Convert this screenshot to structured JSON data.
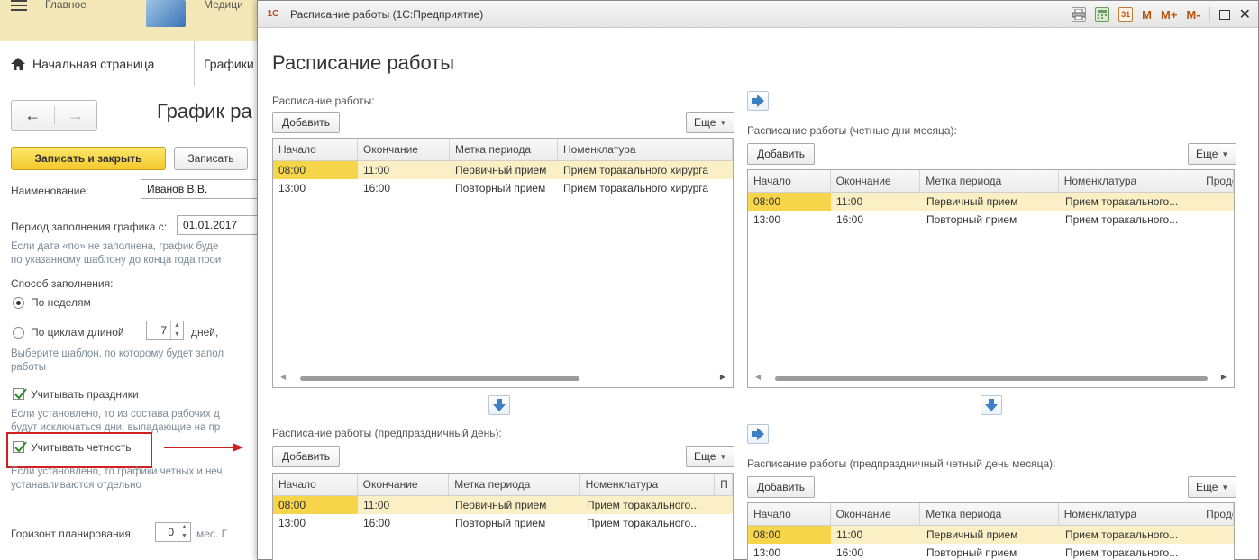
{
  "background": {
    "top_text_left": "Главное",
    "top_text_right": "Медици",
    "home_tab": "Начальная страница",
    "second_tab": "Графики",
    "form_title": "График ра",
    "btn_save_close": "Записать и закрыть",
    "btn_save": "Записать",
    "name_label": "Наименование:",
    "name_value": "Иванов В.В.",
    "period_label": "Период заполнения графика с:",
    "period_value": "01.01.2017",
    "hint_period_1": "Если дата «по» не заполнена, график буде",
    "hint_period_2": "по указанному шаблону до конца года прои",
    "fill_method_label": "Способ заполнения:",
    "radio_weeks": "По неделям",
    "radio_cycles": "По циклам длиной",
    "cycle_value": "7",
    "cycle_unit": "дней,",
    "hint_template_1": "Выберите шаблон, по которому будет запол",
    "hint_template_2": "работы",
    "chk_holidays": "Учитывать праздники",
    "hint_holidays_1": "Если установлено, то из состава рабочих д",
    "hint_holidays_2": "будут исключаться дни, выпадающие на пр",
    "chk_parity": "Учитывать четность",
    "hint_parity_1": "Если установлено, то графики четных и неч",
    "hint_parity_2": "устанавливаются отдельно",
    "horizon_label": "Горизонт планирования:",
    "horizon_value": "0",
    "horizon_unit": "мес. Г"
  },
  "window": {
    "title": "Расписание работы  (1С:Предприятие)",
    "app_logo": "1С",
    "tools": [
      "M",
      "M+",
      "M-"
    ],
    "heading": "Расписание работы"
  },
  "labels": {
    "add": "Добавить",
    "more": "Еще"
  },
  "panels": {
    "main": {
      "label": "Расписание работы:",
      "columns": [
        "Начало",
        "Окончание",
        "Метка периода",
        "Номенклатура"
      ],
      "rows": [
        [
          "08:00",
          "11:00",
          "Первичный прием",
          "Прием торакального хирурга"
        ],
        [
          "13:00",
          "16:00",
          "Повторный прием",
          "Прием торакального хирурга"
        ]
      ]
    },
    "even": {
      "label": "Расписание работы (четные дни месяца):",
      "columns": [
        "Начало",
        "Окончание",
        "Метка периода",
        "Номенклатура",
        "Продо"
      ],
      "rows": [
        [
          "08:00",
          "11:00",
          "Первичный прием",
          "Прием торакального..."
        ],
        [
          "13:00",
          "16:00",
          "Повторный прием",
          "Прием торакального..."
        ]
      ]
    },
    "preholiday": {
      "label": "Расписание работы (предпраздничный день):",
      "columns": [
        "Начало",
        "Окончание",
        "Метка периода",
        "Номенклатура",
        "П"
      ],
      "rows": [
        [
          "08:00",
          "11:00",
          "Первичный прием",
          "Прием торакального..."
        ],
        [
          "13:00",
          "16:00",
          "Повторный прием",
          "Прием торакального..."
        ]
      ]
    },
    "preholiday_even": {
      "label": "Расписание работы (предпраздничный четный день месяца):",
      "columns": [
        "Начало",
        "Окончание",
        "Метка периода",
        "Номенклатура",
        "Продо"
      ],
      "rows": [
        [
          "08:00",
          "11:00",
          "Первичный прием",
          "Прием торакального..."
        ],
        [
          "13:00",
          "16:00",
          "Повторный прием",
          "Прием торакального..."
        ]
      ]
    }
  },
  "colors": {
    "accent_yellow": "#f3c92c",
    "selected_row": "#fbf0c5",
    "selected_cell": "#f7d54a",
    "highlight_red": "#d0201f",
    "arrow_blue": "#3c7fc4"
  }
}
